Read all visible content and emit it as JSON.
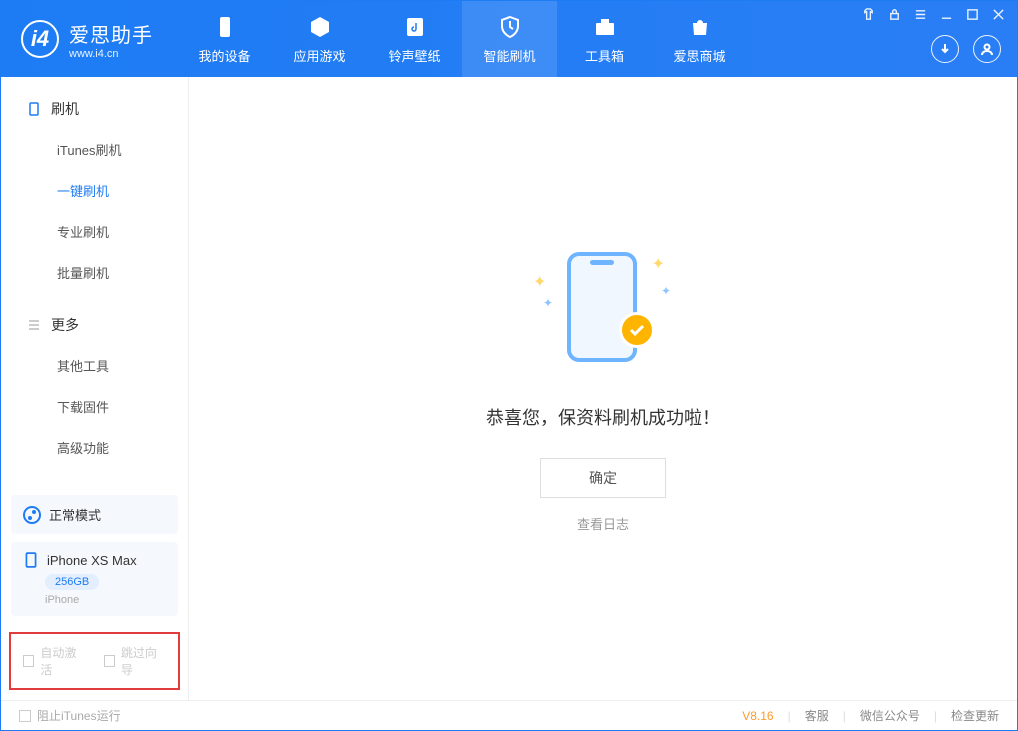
{
  "app": {
    "title": "爱思助手",
    "subtitle": "www.i4.cn"
  },
  "nav": [
    {
      "label": "我的设备",
      "icon": "device"
    },
    {
      "label": "应用游戏",
      "icon": "cube"
    },
    {
      "label": "铃声壁纸",
      "icon": "music"
    },
    {
      "label": "智能刷机",
      "icon": "shield"
    },
    {
      "label": "工具箱",
      "icon": "toolbox"
    },
    {
      "label": "爱思商城",
      "icon": "bag"
    }
  ],
  "sidebar": {
    "section1": {
      "title": "刷机",
      "items": [
        "iTunes刷机",
        "一键刷机",
        "专业刷机",
        "批量刷机"
      ]
    },
    "section2": {
      "title": "更多",
      "items": [
        "其他工具",
        "下载固件",
        "高级功能"
      ]
    }
  },
  "mode_card": {
    "label": "正常模式"
  },
  "device_card": {
    "name": "iPhone XS Max",
    "storage": "256GB",
    "type": "iPhone"
  },
  "red_box": {
    "opt1": "自动激活",
    "opt2": "跳过向导"
  },
  "main": {
    "success": "恭喜您，保资料刷机成功啦！",
    "ok": "确定",
    "log": "查看日志"
  },
  "footer": {
    "block_itunes": "阻止iTunes运行",
    "version": "V8.16",
    "links": [
      "客服",
      "微信公众号",
      "检查更新"
    ]
  }
}
